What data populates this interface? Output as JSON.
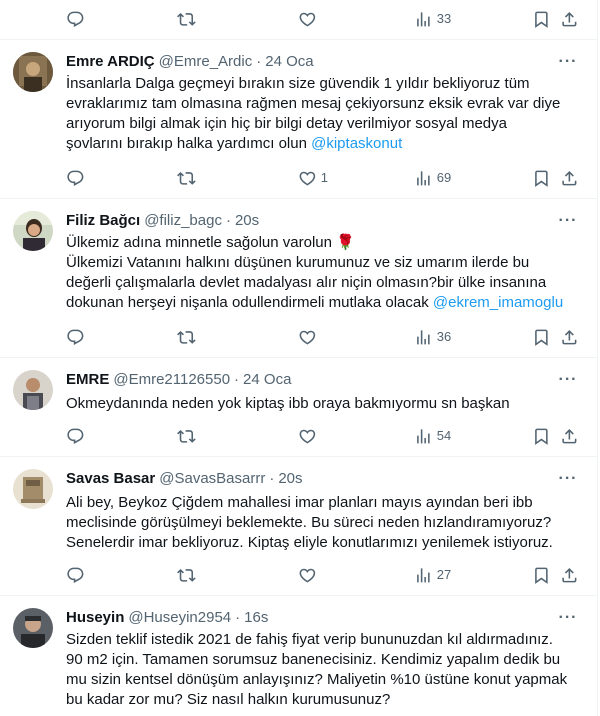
{
  "top_actions": {
    "views": "33"
  },
  "tweets": [
    {
      "name": "Emre ARDIÇ",
      "handle": "@Emre_Ardic",
      "time": "24 Oca",
      "lines": [
        "İnsanlarla Dalga geçmeyi bırakın size güvendik 1 yıldır bekliyoruz tüm",
        "evraklarımız tam olmasına rağmen mesaj çekiyorsunz eksik evrak var diye",
        "arıyorum bilgi almak için hiç bir bilgi detay verilmiyor sosyal medya",
        "şovlarını bırakıp halka yardımcı olun "
      ],
      "mention": "@kiptaskonut",
      "likes": "1",
      "views": "69"
    },
    {
      "name": "Filiz Bağcı",
      "handle": "@filiz_bagc",
      "time": "20s",
      "lines": [
        "Ülkemiz adına minnetle sağolun varolun 🌹",
        "Ülkemizi Vatanını halkını düşünen kurumunuz ve siz umarım ilerde bu",
        "değerli çalışmalarla devlet madalyası alır niçin olmasın?bir ülke insanına",
        "dokunan herşeyi nişanla odullendirmeli mutlaka olacak "
      ],
      "mention": "@ekrem_imamoglu",
      "likes": "",
      "views": "36"
    },
    {
      "name": "EMRE",
      "handle": "@Emre21126550",
      "time": "24 Oca",
      "lines": [
        "Okmeydanında neden yok kiptaş ibb oraya bakmıyormu sn başkan"
      ],
      "mention": "",
      "likes": "",
      "views": "54"
    },
    {
      "name": "Savas Basar",
      "handle": "@SavasBasarrr",
      "time": "20s",
      "lines": [
        "Ali bey, Beykoz Çiğdem mahallesi imar planları mayıs ayından beri ibb",
        "meclisinde görüşülmeyi beklemekte. Bu süreci neden hızlandıramıyoruz?",
        "Senelerdir imar bekliyoruz. Kiptaş eliyle konutlarımızı yenilemek istiyoruz."
      ],
      "mention": "",
      "likes": "",
      "views": "27"
    },
    {
      "name": "Huseyin",
      "handle": "@Huseyin2954",
      "time": "16s",
      "lines": [
        "Sizden teklif istedik 2021 de fahiş fiyat verip bununuzdan kıl aldırmadınız.",
        "90 m2 için. Tamamen sorumsuz  banenecisiniz. Kendimiz yapalım dedik bu",
        "mu sizin kentsel dönüşüm anlayışınız? Maliyetin %10 üstüne konut yapmak",
        "bu kadar zor mu? Siz nasıl halkın kurumusunuz?"
      ],
      "mention": "",
      "likes": "",
      "views": ""
    }
  ]
}
